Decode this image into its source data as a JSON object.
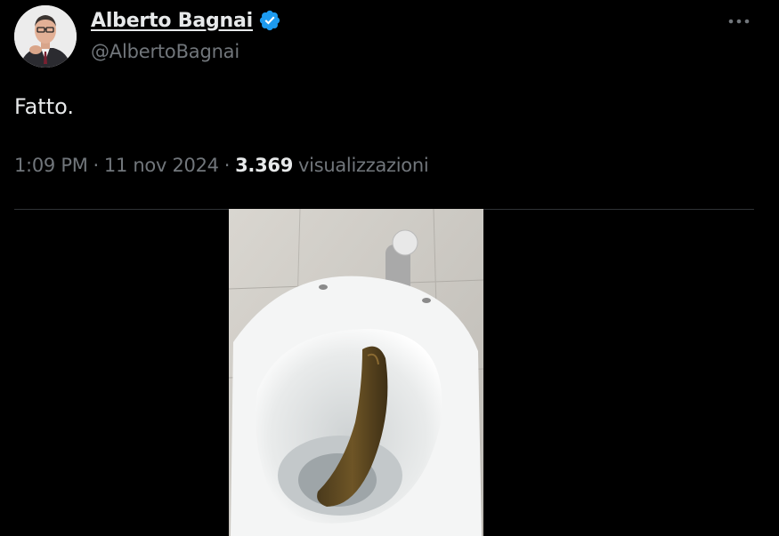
{
  "author": {
    "display_name": "Alberto Bagnai",
    "handle": "@AlbertoBagnai",
    "verified_icon": "verified-badge-icon",
    "avatar_icon": "avatar"
  },
  "tweet": {
    "text": "Fatto.",
    "time": "1:09 PM",
    "separator": "·",
    "date": "11 nov 2024",
    "views_count": "3.369",
    "views_label": "visualizzazioni"
  },
  "menu": {
    "more_icon": "more-horizontal-icon"
  },
  "colors": {
    "background": "#000000",
    "text_primary": "#e7e9ea",
    "text_secondary": "#71767b",
    "verified_blue": "#1d9bf0",
    "divider": "#2f3336"
  }
}
